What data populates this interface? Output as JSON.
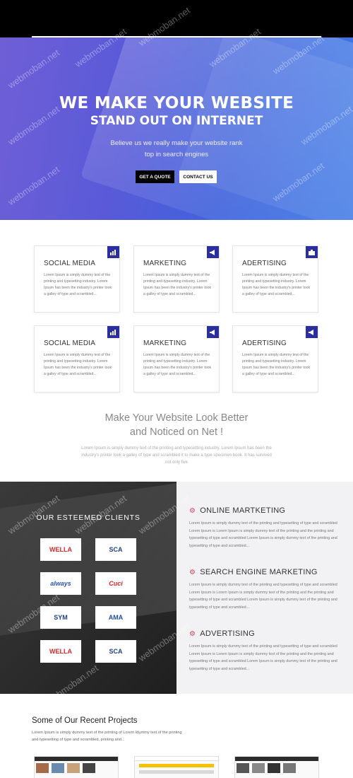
{
  "hero": {
    "title_line1": "WE MAKE YOUR WEBSITE",
    "title_line2": "STAND OUT ON INTERNET",
    "subtitle": "Believe us we really make your website rank top in search engines",
    "quote_button": "GET A QUOTE",
    "contact_button": "CONTACT US"
  },
  "services": [
    {
      "title": "SOCIAL MEDIA",
      "icon": "bar-chart-icon",
      "text": "Lorem Ipsum is simply dummy text of the printing and typesetting industry. Lorem Ipsum has been the industry's printer took a galley of type and scrambled..."
    },
    {
      "title": "MARKETING",
      "icon": "megaphone-icon",
      "text": "Lorem Ipsum is simply dummy text of the printing and typesetting industry. Lorem Ipsum has been the industry's printer took a galley of type and scrambled..."
    },
    {
      "title": "ADERTISING",
      "icon": "briefcase-icon",
      "text": "Lorem Ipsum is simply dummy text of the printing and typesetting industry. Lorem Ipsum has been the industry's printer took a galley of type and scrambled..."
    },
    {
      "title": "SOCIAL MEDIA",
      "icon": "bar-chart-icon",
      "text": "Lorem Ipsum is simply dummy text of the printing and typesetting industry. Lorem Ipsum has been the industry's printer took a galley of type and scrambled..."
    },
    {
      "title": "MARKETING",
      "icon": "megaphone-icon",
      "text": "Lorem Ipsum is simply dummy text of the printing and typesetting industry. Lorem Ipsum has been the industry's printer took a galley of type and scrambled..."
    },
    {
      "title": "ADERTISING",
      "icon": "megaphone-icon",
      "text": "Lorem Ipsum is simply dummy text of the printing and typesetting industry. Lorem Ipsum has been the industry's printer took a galley of type and scrambled..."
    }
  ],
  "intro": {
    "title_line1": "Make Your Website Look Better",
    "title_line2": "and Noticed on Net !",
    "text": "Lorem Ipsum is simply dummy text of the printing and typesetting industry. Lorem Ipsum has been the industry's printer took a galley of type and scrambled it to make a type specimen book. It has survived not only five"
  },
  "clients": {
    "title": "OUR ESTEEMED CLIENTS",
    "logos": [
      "WELLA",
      "SCA",
      "always",
      "Cuci",
      "SYM",
      "AMA",
      "WELLA",
      "SCA"
    ]
  },
  "offerings": [
    {
      "title": "ONLINE MARTKETING",
      "text": "Lorem Ipsum is simply dummy text of the printing and typesetting of type and scrambled Lorem Ipsum is Lorem Ipsum is simply dummy text of the printing and the printing and typesetting of type and scrambled Lorem Ipsum is simply dummy text of the printing and typesetting of type and scrambled..."
    },
    {
      "title": "SEARCH ENGINE MARKETING",
      "text": "Lorem Ipsum is simply dummy text of the printing and typesetting of type and scrambled Lorem Ipsum is Lorem Ipsum is simply dummy text of the printing and the printing and typesetting of type and scrambled Lorem Ipsum is simply dummy text of the printing and typesetting of type and scrambled..."
    },
    {
      "title": "ADVERTISING",
      "text": "Lorem Ipsum is simply dummy text of the printing and typesetting of type and scrambled Lorem Ipsum is Lorem Ipsum is simply dummy text of the printing and the printing and typesetting of type and scrambled Lorem Ipsum is simply dummy text of the printing and typesetting of type and scrambled..."
    }
  ],
  "projects": {
    "title": "Some of Our Recent Projects",
    "text": "Lorem Ipsum is simply dummy text of the printing of Lorem Idummy text of the printing and typesetting of type and scrambled, printing and..."
  },
  "watermark": "webmoban.net",
  "colors": {
    "accent": "#2b2e9e",
    "gear": "#e2405a",
    "hero_start": "#6f5fd6",
    "hero_end": "#3c78e6"
  }
}
